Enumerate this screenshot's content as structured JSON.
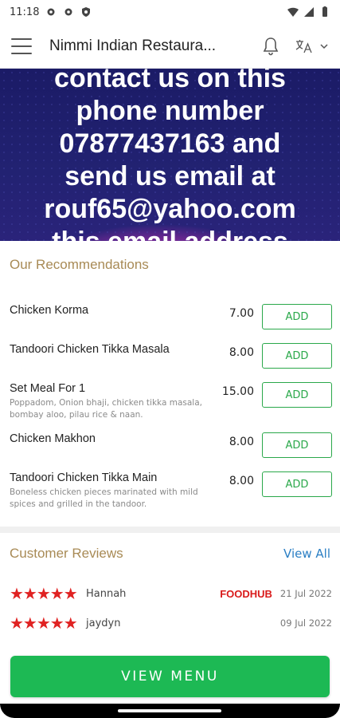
{
  "status_bar": {
    "time": "11:18"
  },
  "app_bar": {
    "title": "Nimmi Indian Restaura..."
  },
  "banner": {
    "lines": [
      "contact us on this",
      "phone number",
      "07877437163 and",
      "send us email at",
      "rouf65@yahoo.com",
      "this email address"
    ]
  },
  "recommendations": {
    "title": "Our Recommendations",
    "items": [
      {
        "name": "Chicken Korma",
        "desc": "",
        "price": "7.00",
        "add_label": "ADD"
      },
      {
        "name": "Tandoori Chicken Tikka Masala",
        "desc": "",
        "price": "8.00",
        "add_label": "ADD"
      },
      {
        "name": "Set Meal For 1",
        "desc": "Poppadom, Onion bhaji, chicken tikka masala, bombay aloo, pilau rice & naan.",
        "price": "15.00",
        "add_label": "ADD"
      },
      {
        "name": "Chicken Makhon",
        "desc": "",
        "price": "8.00",
        "add_label": "ADD"
      },
      {
        "name": "Tandoori Chicken Tikka Main",
        "desc": "Boneless chicken pieces marinated with mild spices and grilled in the tandoor.",
        "price": "8.00",
        "add_label": "ADD"
      }
    ]
  },
  "reviews": {
    "title": "Customer Reviews",
    "view_all": "View All",
    "items": [
      {
        "stars": "★★★★★",
        "rating": 5,
        "name": "Hannah",
        "source": "FOODHUB",
        "date": "21 Jul 2022"
      },
      {
        "stars": "★★★★★",
        "rating": 5,
        "name": "jaydyn",
        "source": "",
        "date": "09 Jul 2022"
      }
    ]
  },
  "footer": {
    "view_menu_label": "VIEW MENU"
  },
  "colors": {
    "accent_green": "#1db954",
    "title_gold": "#a88a55",
    "link_blue": "#2b7fc4",
    "star_red": "#e02222"
  }
}
